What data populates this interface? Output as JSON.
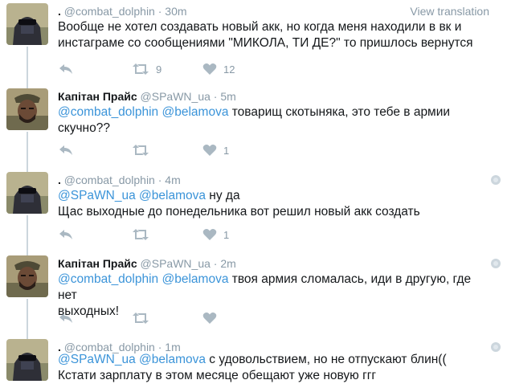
{
  "tweets": [
    {
      "display_name": ".",
      "handle": "@combat_dolphin",
      "time": "30m",
      "view_translation": "View translation",
      "segments": [
        {
          "t": "Вообще не хотел создавать новый акк, но когда меня находили в вк и\nинстаграме со сообщениями \"МИКОЛА, ТИ ДЕ?\" то пришлось вернутся",
          "m": false
        }
      ],
      "retweets": "9",
      "likes": "12"
    },
    {
      "display_name": "Капітан Прайс",
      "handle": "@SPaWN_ua",
      "time": "5m",
      "segments": [
        {
          "t": "@combat_dolphin",
          "m": true
        },
        {
          "t": " ",
          "m": false
        },
        {
          "t": "@belamova",
          "m": true
        },
        {
          "t": " товарищ скотыняка, это тебе в армии\nскучно??",
          "m": false
        }
      ],
      "retweets": "",
      "likes": "1"
    },
    {
      "display_name": ".",
      "handle": "@combat_dolphin",
      "time": "4m",
      "segments": [
        {
          "t": "@SPaWN_ua",
          "m": true
        },
        {
          "t": " ",
          "m": false
        },
        {
          "t": "@belamova",
          "m": true
        },
        {
          "t": " ну да\nЩас выходные до понедельника вот решил новый акк создать",
          "m": false
        }
      ],
      "retweets": "",
      "likes": "1"
    },
    {
      "display_name": "Капітан Прайс",
      "handle": "@SPaWN_ua",
      "time": "2m",
      "segments": [
        {
          "t": "@combat_dolphin",
          "m": true
        },
        {
          "t": " ",
          "m": false
        },
        {
          "t": "@belamova",
          "m": true
        },
        {
          "t": " твоя армия сломалась, иди в другую, где нет\nвыходных!",
          "m": false
        }
      ],
      "retweets": "",
      "likes": ""
    },
    {
      "display_name": ".",
      "handle": "@combat_dolphin",
      "time": "1m",
      "segments": [
        {
          "t": "@SPaWN_ua",
          "m": true
        },
        {
          "t": " ",
          "m": false
        },
        {
          "t": "@belamova",
          "m": true
        },
        {
          "t": " с удовольствием, но не отпускают блин((\nКстати зарплату в этом месяце обещают уже новую ггг",
          "m": false
        }
      ],
      "retweets": "",
      "likes": ""
    }
  ],
  "separator": "·",
  "icons": [
    "reply-icon",
    "retweet-icon",
    "heart-icon",
    "globe-icon"
  ],
  "colors": {
    "mention": "#3b94d9",
    "meta": "#8899a6",
    "icon": "#aab8c2",
    "connector": "#ccd6dd"
  }
}
